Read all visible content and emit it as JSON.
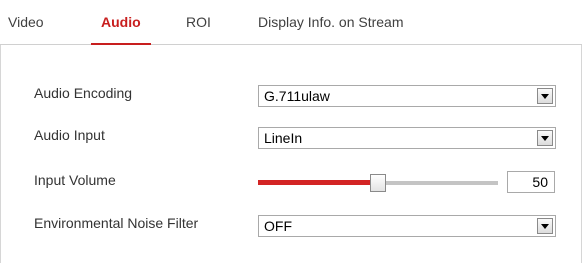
{
  "tabs": [
    {
      "label": "Video",
      "active": false
    },
    {
      "label": "Audio",
      "active": true
    },
    {
      "label": "ROI",
      "active": false
    },
    {
      "label": "Display Info. on Stream",
      "active": false
    }
  ],
  "form": {
    "audio_encoding": {
      "label": "Audio Encoding",
      "value": "G.711ulaw"
    },
    "audio_input": {
      "label": "Audio Input",
      "value": "LineIn"
    },
    "input_volume": {
      "label": "Input Volume",
      "value": "50",
      "level_percent": 50
    },
    "noise_filter": {
      "label": "Environmental Noise Filter",
      "value": "OFF"
    }
  },
  "colors": {
    "accent": "#c81e1e",
    "slider_fill": "#d32424",
    "slider_track": "#c4c4c4"
  },
  "icons": {
    "dropdown": "chevron-down-icon"
  }
}
